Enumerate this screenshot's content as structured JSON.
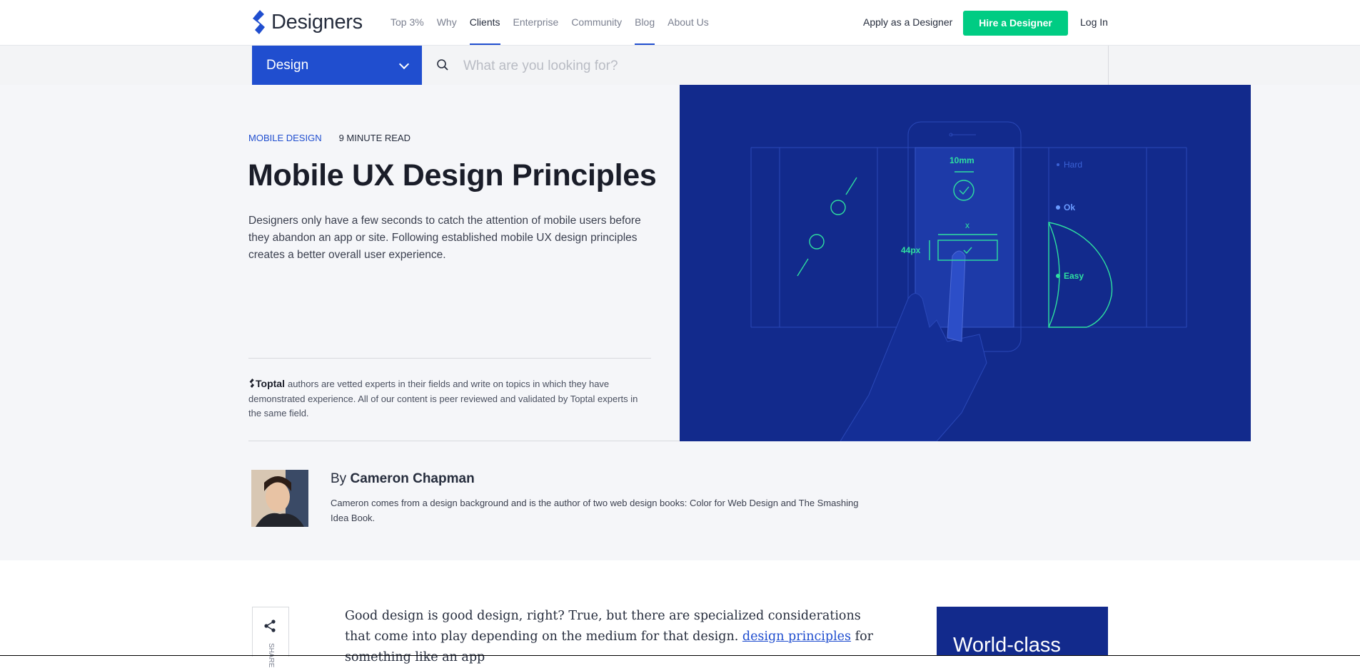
{
  "header": {
    "brand": "Designers",
    "nav": [
      {
        "label": "Top 3%"
      },
      {
        "label": "Why"
      },
      {
        "label": "Clients"
      },
      {
        "label": "Enterprise"
      },
      {
        "label": "Community"
      },
      {
        "label": "Blog"
      },
      {
        "label": "About Us"
      }
    ],
    "apply_label": "Apply as a Designer",
    "hire_label": "Hire a Designer",
    "login_label": "Log In",
    "accent_color": "#204ecf",
    "cta_color": "#00cc83"
  },
  "search": {
    "category": "Design",
    "placeholder": "What are you looking for?"
  },
  "article": {
    "category": "MOBILE DESIGN",
    "read_time": "9 MINUTE READ",
    "title": "Mobile UX Design Principles",
    "lead": "Designers only have a few seconds to catch the attention of mobile users before they abandon an app or site. Following established mobile UX design principles creates a better overall user experience.",
    "vetted_brand": "Toptal",
    "vetted_text": "authors are vetted experts in their fields and write on topics in which they have demonstrated experience. All of our content is peer reviewed and validated by Toptal experts in the same field.",
    "illustration": {
      "labels": {
        "mm": "10mm",
        "px": "44px",
        "x": "x",
        "hard": "Hard",
        "ok": "Ok",
        "easy": "Easy"
      },
      "bg_color": "#122a8c"
    }
  },
  "author": {
    "by": "By",
    "name": "Cameron Chapman",
    "bio": "Cameron comes from a design background and is the author of two web design books: Color for Web Design and The Smashing Idea Book."
  },
  "body": {
    "text_1": "Good design is good design, right? True, but there are specialized considerations that come into play depending on the medium for that design. ",
    "link": "design principles",
    "text_2": " for something like an app",
    "share_label": "SHARE"
  },
  "promo": {
    "text": "World-class"
  }
}
